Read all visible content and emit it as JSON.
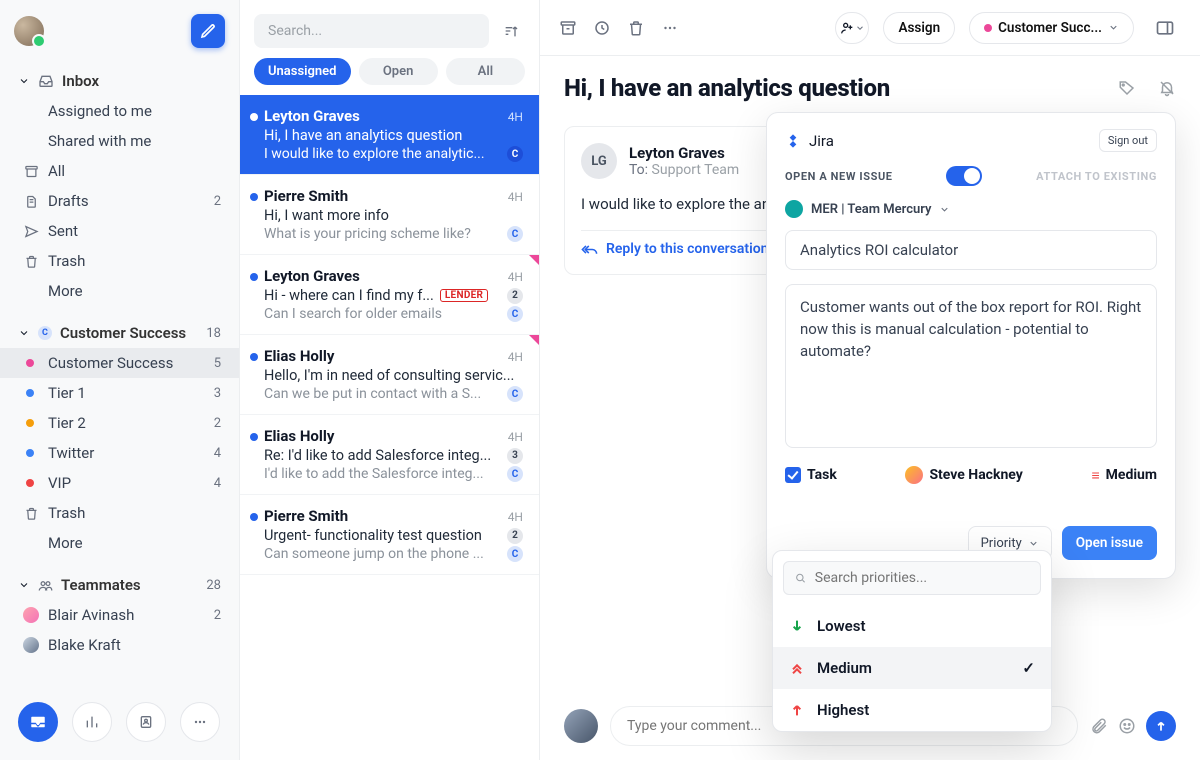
{
  "sidebar": {
    "inbox": {
      "title": "Inbox",
      "items": [
        {
          "label": "Assigned to me"
        },
        {
          "label": "Shared with me"
        },
        {
          "label": "All",
          "icon": "archive"
        },
        {
          "label": "Drafts",
          "count": "2",
          "icon": "draft"
        },
        {
          "label": "Sent",
          "icon": "send"
        },
        {
          "label": "Trash",
          "icon": "trash"
        },
        {
          "label": "More"
        }
      ]
    },
    "team_section": {
      "title": "Customer Success",
      "count": "18",
      "items": [
        {
          "label": "Customer Success",
          "count": "5",
          "dot": "#ec4899",
          "active": true
        },
        {
          "label": "Tier 1",
          "count": "3",
          "dot": "#3b82f6"
        },
        {
          "label": "Tier 2",
          "count": "2",
          "dot": "#f59e0b"
        },
        {
          "label": "Twitter",
          "count": "4",
          "dot": "#3b82f6"
        },
        {
          "label": "VIP",
          "count": "4",
          "dot": "#ef4444"
        },
        {
          "label": "Trash",
          "icon": "trash"
        },
        {
          "label": "More"
        }
      ]
    },
    "teammates": {
      "title": "Teammates",
      "count": "28",
      "items": [
        {
          "label": "Blair Avinash",
          "count": "2"
        },
        {
          "label": "Blake Kraft"
        }
      ]
    }
  },
  "list": {
    "search_placeholder": "Search...",
    "tabs": {
      "unassigned": "Unassigned",
      "open": "Open",
      "all": "All"
    },
    "items": [
      {
        "sender": "Leyton Graves",
        "time": "4H",
        "subject": "Hi, I have an analytics question",
        "preview": "I would like to explore the analytic...",
        "active": true,
        "unread": true,
        "badge": "C"
      },
      {
        "sender": "Pierre Smith",
        "time": "4H",
        "subject": "Hi, I want more info",
        "preview": "What is your pricing scheme like?",
        "unread": true,
        "badge": "C"
      },
      {
        "sender": "Leyton Graves",
        "time": "4H",
        "subject": "Hi - where can I find my f...",
        "tag": "LENDER",
        "count": "2",
        "preview": "Can I search for older emails",
        "unread": true,
        "flash": true,
        "badge": "C"
      },
      {
        "sender": "Elias Holly",
        "time": "4H",
        "subject": "Hello, I'm in need of consulting servic...",
        "preview": "Can we be put in contact with a S...",
        "unread": true,
        "flash": true,
        "badge": "C"
      },
      {
        "sender": "Elias Holly",
        "time": "4H",
        "subject": "Re: I'd like to add Salesforce integ...",
        "count": "3",
        "preview": "I'd like to add the Salesforce integ...",
        "unread": true,
        "badge": "C"
      },
      {
        "sender": "Pierre Smith",
        "time": "4H",
        "subject": "Urgent- functionality test question",
        "count": "2",
        "preview": "Can someone jump on the phone ...",
        "unread": true,
        "badge": "C"
      }
    ]
  },
  "main": {
    "assign": "Assign",
    "team_pill": "Customer Succ...",
    "title": "Hi, I have an analytics question",
    "message": {
      "initials": "LG",
      "from": "Leyton Graves",
      "to_label": "To:",
      "to": "Support Team",
      "body": "I would like to explore the analytics of the product. Do you have resources.",
      "reply": "Reply to this conversation"
    },
    "composer_placeholder": "Type your comment..."
  },
  "panel": {
    "app": "Jira",
    "signout": "Sign out",
    "mode_open": "OPEN A NEW ISSUE",
    "mode_attach": "ATTACH TO EXISTING",
    "project": "MER | Team Mercury",
    "summary": "Analytics ROI calculator",
    "description": "Customer wants out of the box report for ROI. Right now this is manual calculation - potential to automate?",
    "type": "Task",
    "assignee": "Steve Hackney",
    "priority": "Medium",
    "priority_btn": "Priority",
    "open_issue": "Open issue",
    "dd": {
      "search_placeholder": "Search priorities...",
      "options": [
        {
          "label": "Lowest",
          "icon": "down",
          "color": "#16a34a"
        },
        {
          "label": "Medium",
          "icon": "double-up",
          "color": "#ef4444",
          "selected": true
        },
        {
          "label": "Highest",
          "icon": "up",
          "color": "#ef4444"
        }
      ]
    }
  }
}
